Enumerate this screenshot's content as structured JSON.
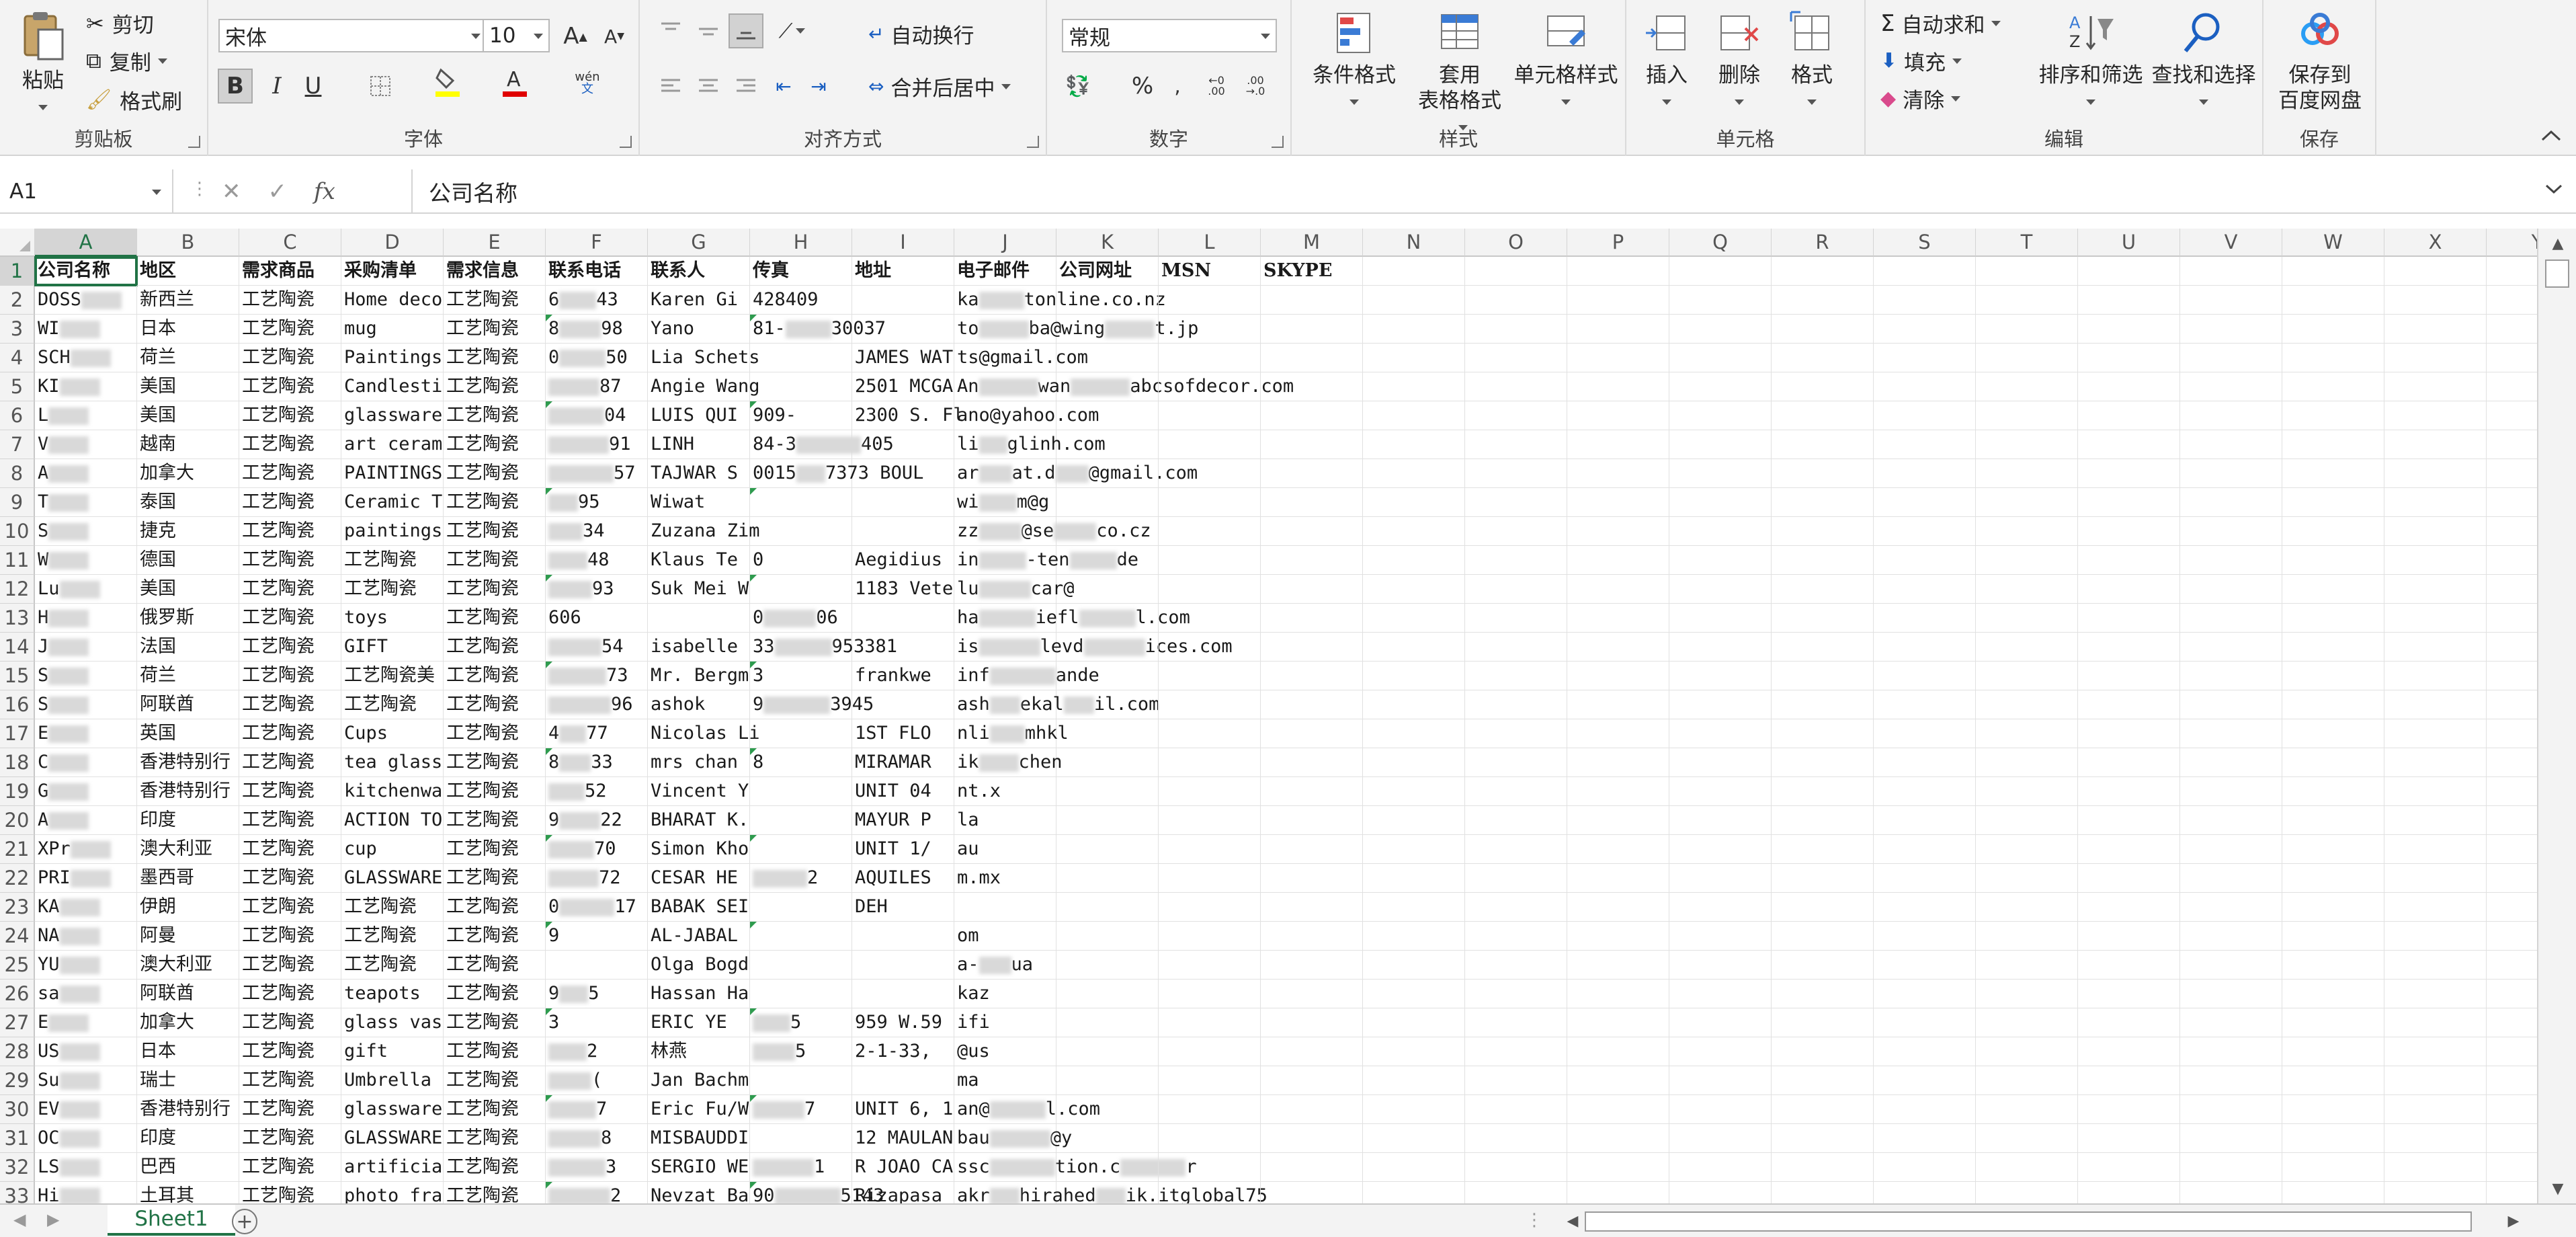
{
  "ribbon": {
    "clipboard": {
      "label": "剪贴板",
      "paste": "粘贴",
      "cut": "剪切",
      "copy": "复制",
      "format_painter": "格式刷"
    },
    "font": {
      "label": "字体",
      "font_name": "宋体",
      "font_size": "10",
      "bold": "B",
      "italic": "I",
      "underline": "U",
      "phonetic": "wén"
    },
    "alignment": {
      "label": "对齐方式",
      "wrap_text": "自动换行",
      "merge_center": "合并后居中"
    },
    "number": {
      "label": "数字",
      "format": "常规",
      "percent": "%"
    },
    "styles": {
      "label": "样式",
      "conditional": "条件格式",
      "table_format_1": "套用",
      "table_format_2": "表格格式",
      "cell_styles": "单元格样式"
    },
    "cells": {
      "label": "单元格",
      "insert": "插入",
      "delete": "删除",
      "format": "格式"
    },
    "editing": {
      "label": "编辑",
      "autosum": "自动求和",
      "fill": "填充",
      "clear": "清除",
      "sort_filter": "排序和筛选",
      "find_select": "查找和选择"
    },
    "save": {
      "label": "保存",
      "save_to_1": "保存到",
      "save_to_2": "百度网盘"
    }
  },
  "formula_bar": {
    "name_box": "A1",
    "fx": "fx",
    "content": "公司名称"
  },
  "columns": [
    "A",
    "B",
    "C",
    "D",
    "E",
    "F",
    "G",
    "H",
    "I",
    "J",
    "K",
    "L",
    "M",
    "N",
    "O",
    "P",
    "Q",
    "R",
    "S",
    "T",
    "U",
    "V",
    "W",
    "X",
    "Y"
  ],
  "header_row": [
    "公司名称",
    "地区",
    "需求商品",
    "采购清单",
    "需求信息",
    "联系电话",
    "联系人",
    "传真",
    "地址",
    "电子邮件",
    "公司网址",
    "MSN",
    "SKYPE"
  ],
  "rows": [
    {
      "n": "2",
      "a": "DOSS",
      "b": "新西兰",
      "c": "工艺陶瓷",
      "d": "Home deco",
      "e": "工艺陶瓷",
      "f": "6",
      "f2": "43",
      "g": "Karen Gi",
      "h": "428409",
      "j": "ka",
      "j2": "tonline.co.nz"
    },
    {
      "n": "3",
      "a": "WI",
      "b": "日本",
      "c": "工艺陶瓷",
      "d": "mug",
      "e": "工艺陶瓷",
      "f": "8",
      "f2": "98",
      "g": "Yano",
      "h": "81-",
      "h2": "30037",
      "j": "to",
      "j2": "ba@wing",
      "j3": "t.jp"
    },
    {
      "n": "4",
      "a": "SCH",
      "b": "荷兰",
      "c": "工艺陶瓷",
      "d": "Paintings",
      "e": "工艺陶瓷",
      "f": "0",
      "f2": "50",
      "g": "Lia Schets",
      "i": "JAMES WAT",
      "j": "ts@gmail.com"
    },
    {
      "n": "5",
      "a": "KI",
      "b": "美国",
      "c": "工艺陶瓷",
      "d": "Candlesti",
      "e": "工艺陶瓷",
      "f2": "87",
      "g": "Angie Wang",
      "i": "2501 MCGA",
      "j": "An",
      "j2": "wan",
      "j3": "abcsofdecor.com"
    },
    {
      "n": "6",
      "a": "L",
      "b": "美国",
      "c": "工艺陶瓷",
      "d": "glassware",
      "e": "工艺陶瓷",
      "f2": "04",
      "g": "LUIS QUI",
      "h": "909-",
      "i": "2300 S. Fl",
      "j": "ano@yahoo.com"
    },
    {
      "n": "7",
      "a": "V",
      "b": "越南",
      "c": "工艺陶瓷",
      "d": "art ceram",
      "e": "工艺陶瓷",
      "f2": "91",
      "g": "LINH",
      "h": "84-3",
      "h2": "405",
      "j": "li",
      "j2": "glinh.com"
    },
    {
      "n": "8",
      "a": "A",
      "b": "加拿大",
      "c": "工艺陶瓷",
      "d": "PAINTINGS",
      "e": "工艺陶瓷",
      "f2": "57",
      "g": "TAJWAR S",
      "h": "0015",
      "h2": "7373 BOUL",
      "j": "ar",
      "j2": "at.d",
      "j3": "@gmail.com"
    },
    {
      "n": "9",
      "a": "T",
      "b": "泰国",
      "c": "工艺陶瓷",
      "d": "Ceramic T",
      "e": "工艺陶瓷",
      "f2": "95",
      "g": "Wiwat",
      "j": "wi",
      "j2": "m@g"
    },
    {
      "n": "10",
      "a": "S",
      "b": "捷克",
      "c": "工艺陶瓷",
      "d": "paintings",
      "e": "工艺陶瓷",
      "f2": "34",
      "g": "Zuzana Zim",
      "j": "zz",
      "j2": "@se",
      "j3": "co.cz"
    },
    {
      "n": "11",
      "a": "W",
      "b": "德国",
      "c": "工艺陶瓷",
      "d": "工艺陶瓷",
      "e": "工艺陶瓷",
      "f2": "48",
      "g": "Klaus Te",
      "h": "0",
      "i": "Aegidius",
      "j": "in",
      "j2": "-ten",
      "j3": "de"
    },
    {
      "n": "12",
      "a": "Lu",
      "b": "美国",
      "c": "工艺陶瓷",
      "d": "工艺陶瓷",
      "e": "工艺陶瓷",
      "f2": "93",
      "g": "Suk Mei W",
      "i": "1183 Vete",
      "j": "lu",
      "j2": "car@"
    },
    {
      "n": "13",
      "a": "H",
      "b": "俄罗斯",
      "c": "工艺陶瓷",
      "d": "toys",
      "e": "工艺陶瓷",
      "f": "606",
      "h": "0",
      "h2": "06",
      "j": "ha",
      "j2": "iefl",
      "j3": "l.com"
    },
    {
      "n": "14",
      "a": "J",
      "b": "法国",
      "c": "工艺陶瓷",
      "d": "GIFT",
      "e": "工艺陶瓷",
      "f2": "54",
      "g": "isabelle",
      "h": "33",
      "h2": "953381",
      "j": "is",
      "j2": "levd",
      "j3": "ices.com"
    },
    {
      "n": "15",
      "a": "S",
      "b": "荷兰",
      "c": "工艺陶瓷",
      "d": "工艺陶瓷美",
      "e": "工艺陶瓷",
      "f2": "73",
      "g": "Mr. Bergm",
      "h": "3",
      "i": "frankwe",
      "j": "inf",
      "j2": "ande"
    },
    {
      "n": "16",
      "a": "S",
      "b": "阿联酋",
      "c": "工艺陶瓷",
      "d": "工艺陶瓷",
      "e": "工艺陶瓷",
      "f2": "96",
      "g": "ashok",
      "h": "9",
      "h2": "3945",
      "j": "ash",
      "j2": "ekal",
      "j3": "il.com"
    },
    {
      "n": "17",
      "a": "E",
      "b": "英国",
      "c": "工艺陶瓷",
      "d": "Cups",
      "e": "工艺陶瓷",
      "f": "4",
      "f2": "77",
      "g": "Nicolas Li",
      "i": "1ST FLO",
      "j": "nli",
      "j2": "mhkl"
    },
    {
      "n": "18",
      "a": "C",
      "b": "香港特别行",
      "c": "工艺陶瓷",
      "d": "tea glass",
      "e": "工艺陶瓷",
      "f": "8",
      "f2": "33",
      "g": "mrs chan",
      "h": "8",
      "i": "MIRAMAR",
      "j": "ik",
      "j2": "chen"
    },
    {
      "n": "19",
      "a": "G",
      "b": "香港特别行",
      "c": "工艺陶瓷",
      "d": "kitchenwa",
      "e": "工艺陶瓷",
      "f2": "52",
      "g": "Vincent Y",
      "i": "UNIT 04",
      "j": "nt.x"
    },
    {
      "n": "20",
      "a": "A",
      "b": "印度",
      "c": "工艺陶瓷",
      "d": "ACTION TO",
      "e": "工艺陶瓷",
      "f": "9",
      "f2": "22",
      "g": "BHARAT K.",
      "i": "MAYUR P",
      "j": "la"
    },
    {
      "n": "21",
      "a": "XPr",
      "b": "澳大利亚",
      "c": "工艺陶瓷",
      "d": "cup",
      "e": "工艺陶瓷",
      "f2": "70",
      "g": "Simon Kho",
      "i": "UNIT 1/",
      "j": "au"
    },
    {
      "n": "22",
      "a": "PRI",
      "b": "墨西哥",
      "c": "工艺陶瓷",
      "d": "GLASSWARE",
      "e": "工艺陶瓷",
      "f2": "72",
      "g": "CESAR HE",
      "h2": "2",
      "i": "AQUILES",
      "j": "m.mx"
    },
    {
      "n": "23",
      "a": "KA",
      "b": "伊朗",
      "c": "工艺陶瓷",
      "d": "工艺陶瓷",
      "e": "工艺陶瓷",
      "f": "0",
      "f2": "17",
      "g": "BABAK SEI",
      "i": "DEH"
    },
    {
      "n": "24",
      "a": "NA",
      "b": "阿曼",
      "c": "工艺陶瓷",
      "d": "工艺陶瓷",
      "e": "工艺陶瓷",
      "f": "9",
      "g": "AL-JABAL",
      "j": "om"
    },
    {
      "n": "25",
      "a": "YU",
      "b": "澳大利亚",
      "c": "工艺陶瓷",
      "d": "工艺陶瓷",
      "e": "工艺陶瓷",
      "g": "Olga Bogd",
      "j": "a-",
      "j2": "ua"
    },
    {
      "n": "26",
      "a": "sa",
      "b": "阿联酋",
      "c": "工艺陶瓷",
      "d": "teapots",
      "e": "工艺陶瓷",
      "f": "9",
      "f2": "5",
      "g": "Hassan Ha",
      "j": "kaz"
    },
    {
      "n": "27",
      "a": "E",
      "b": "加拿大",
      "c": "工艺陶瓷",
      "d": "glass vas",
      "e": "工艺陶瓷",
      "f": "3",
      "g": "ERIC YE",
      "h2": "5",
      "i": "959 W.59",
      "j": "ifi"
    },
    {
      "n": "28",
      "a": "US",
      "b": "日本",
      "c": "工艺陶瓷",
      "d": "gift",
      "e": "工艺陶瓷",
      "f2": "2",
      "g": "林燕",
      "h2": "5",
      "i": "2-1-33,",
      "j": "@us"
    },
    {
      "n": "29",
      "a": "Su",
      "b": "瑞士",
      "c": "工艺陶瓷",
      "d": "Umbrella",
      "e": "工艺陶瓷",
      "f2": "(",
      "g": "Jan Bachm",
      "j": "ma"
    },
    {
      "n": "30",
      "a": "EV",
      "b": "香港特别行",
      "c": "工艺陶瓷",
      "d": "glassware",
      "e": "工艺陶瓷",
      "f2": "7",
      "g": "Eric Fu/W",
      "h2": "7",
      "i": "UNIT 6, 1",
      "j": "an@",
      "j2": "l.com"
    },
    {
      "n": "31",
      "a": "OC",
      "b": "印度",
      "c": "工艺陶瓷",
      "d": "GLASSWARE",
      "e": "工艺陶瓷",
      "f2": "8",
      "g": "MISBAUDDI",
      "i": "12 MAULAN",
      "j": "bau",
      "j2": "@y"
    },
    {
      "n": "32",
      "a": "LS",
      "b": "巴西",
      "c": "工艺陶瓷",
      "d": "artificia",
      "e": "工艺陶瓷",
      "f2": "3",
      "g": "SERGIO WE",
      "h2": "1",
      "i": "R JOAO CA",
      "j": "ssc",
      "j2": "tion.c",
      "j3": "r"
    },
    {
      "n": "33",
      "a": "Hi",
      "b": "土耳其",
      "c": "工艺陶瓷",
      "d": "photo fra",
      "e": "工艺陶瓷",
      "f2": "2",
      "g": "Nevzat Ba",
      "h": "90",
      "h2": "5143",
      "i": "Rizapasa",
      "j": "akr",
      "j2": "hirahed",
      "j3": "ik.itglobal75"
    }
  ],
  "sheet_tabs": [
    "Sheet1"
  ]
}
